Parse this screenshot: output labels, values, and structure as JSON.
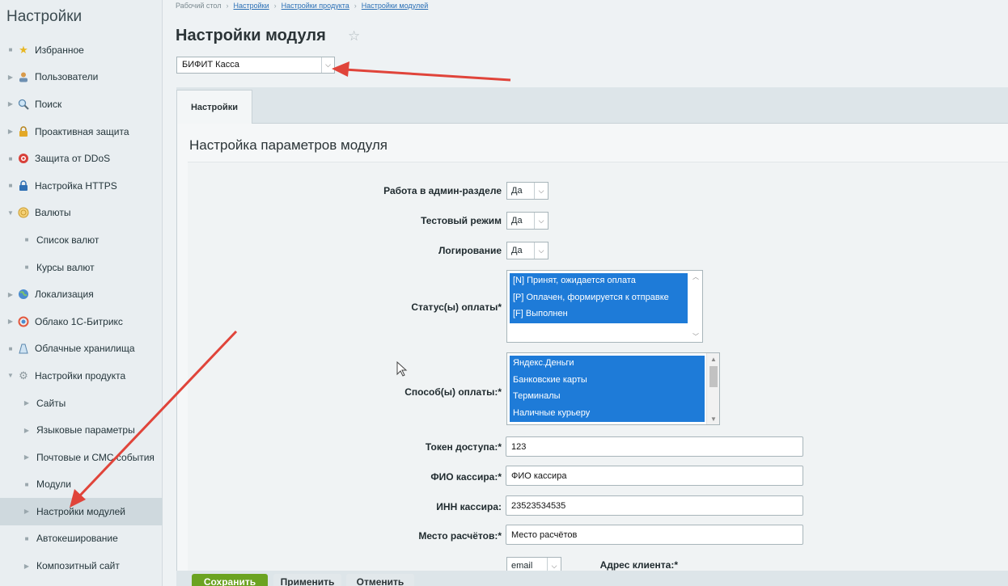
{
  "sidebar": {
    "title": "Настройки",
    "items": [
      {
        "label": "Избранное",
        "icon": "star-icon",
        "marker": "dot"
      },
      {
        "label": "Пользователи",
        "icon": "user-icon",
        "marker": "arrow"
      },
      {
        "label": "Поиск",
        "icon": "search-icon",
        "marker": "arrow"
      },
      {
        "label": "Проактивная защита",
        "icon": "lock-icon",
        "marker": "arrow"
      },
      {
        "label": "Защита от DDoS",
        "icon": "shield-icon",
        "marker": "dot"
      },
      {
        "label": "Настройка HTTPS",
        "icon": "padlock-icon",
        "marker": "dot"
      },
      {
        "label": "Валюты",
        "icon": "currency-icon",
        "marker": "open"
      },
      {
        "label": "Список валют",
        "sub": true,
        "marker": "dot"
      },
      {
        "label": "Курсы валют",
        "sub": true,
        "marker": "dot"
      },
      {
        "label": "Локализация",
        "icon": "globe-icon",
        "marker": "arrow"
      },
      {
        "label": "Облако 1С-Битрикс",
        "icon": "cloud-icon",
        "marker": "arrow"
      },
      {
        "label": "Облачные хранилища",
        "icon": "storage-icon",
        "marker": "dot"
      },
      {
        "label": "Настройки продукта",
        "icon": "gear-icon",
        "marker": "open"
      },
      {
        "label": "Сайты",
        "sub": true,
        "marker": "arrow"
      },
      {
        "label": "Языковые параметры",
        "sub": true,
        "marker": "arrow"
      },
      {
        "label": "Почтовые и СМС события",
        "sub": true,
        "marker": "arrow"
      },
      {
        "label": "Модули",
        "sub": true,
        "marker": "dot"
      },
      {
        "label": "Настройки модулей",
        "sub": true,
        "marker": "arrow",
        "active": true
      },
      {
        "label": "Автокеширование",
        "sub": true,
        "marker": "dot"
      },
      {
        "label": "Композитный сайт",
        "sub": true,
        "marker": "arrow"
      }
    ]
  },
  "breadcrumb": {
    "items": [
      "Рабочий стол",
      "Настройки",
      "Настройки продукта",
      "Настройки модулей"
    ]
  },
  "page": {
    "title": "Настройки модуля",
    "module_select_value": "БИФИТ Касса"
  },
  "tabs": {
    "settings_label": "Настройки"
  },
  "section": {
    "title": "Настройка параметров модуля"
  },
  "form": {
    "admin_label": "Работа в админ-разделе",
    "admin_value": "Да",
    "test_label": "Тестовый режим",
    "test_value": "Да",
    "log_label": "Логирование",
    "log_value": "Да",
    "status_label": "Статус(ы) оплаты*",
    "status_options": [
      "[N] Принят, ожидается оплата",
      "[P] Оплачен, формируется к отправке",
      "[F] Выполнен"
    ],
    "payment_label": "Способ(ы) оплаты:*",
    "payment_options": [
      "Яндекс.Деньги",
      "Банковские карты",
      "Терминалы",
      "Наличные курьеру"
    ],
    "token_label": "Токен доступа:*",
    "token_value": "123",
    "fio_label": "ФИО кассира:*",
    "fio_value": "ФИО кассира",
    "inn_label": "ИНН кассира:",
    "inn_value": "23523534535",
    "place_label": "Место расчётов:*",
    "place_value": "Место расчётов",
    "client_label": "Адрес клиента:*",
    "client_value": "email"
  },
  "buttons": {
    "save": "Сохранить",
    "apply": "Применить",
    "cancel": "Отменить"
  },
  "colors": {
    "selection": "#1e7bd8",
    "save_button": "#6ba321",
    "annotation_arrow": "#e0443a"
  }
}
